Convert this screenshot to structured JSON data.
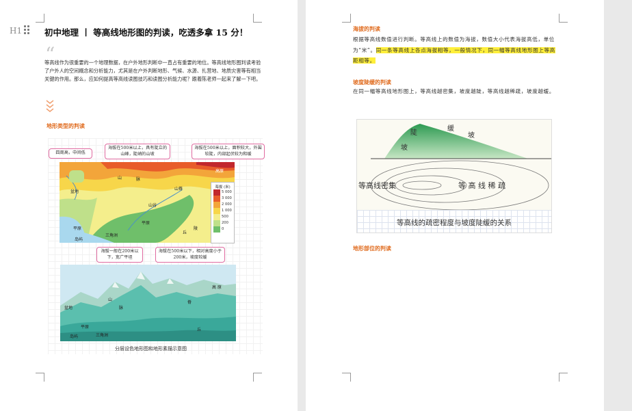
{
  "left_page": {
    "heading_icon": "H1",
    "title": "初中地理 丨 等高线地形图的判读，吃透多拿 15 分！",
    "quote_mark": "“",
    "intro": "等高线作为很重要的一个地理数据，在户外地形判断中一直占有重要的地位。等高线地形图判读考验了户外人的空间概念和分析能力，尤其是在户外判断地形、气候、水源、扎营地、地质灾害等有相当关键的作用。那么，应如何提高等高线读图技巧和读图分析能力呢？跟着陈老师一起来了解一下吧。",
    "section_heading": "地形类型的判读",
    "callouts": {
      "basin": "四周高，中间低",
      "mountain": "海拔在500米以上，具有陡立的山峰，陡峭的山坡",
      "plateau": "海拔在500米以上，面积较大，外围较陡，内部起伏较为和缓",
      "plain": "海拔一般在200米以下，宽广平坦",
      "hills": "海拔在500米以下，相对高度小于200米，坡度较缓"
    },
    "map_labels": {
      "basin": "盆地",
      "mountain": "山",
      "range": "脉",
      "ridge": "山脊",
      "plateau": "高原",
      "valley": "山谷",
      "plain": "平原",
      "plain2": "平原",
      "delta": "三角洲",
      "island": "岛屿",
      "hills": "丘",
      "hills2": "陵"
    },
    "legend": {
      "title": "海拔 (米)",
      "rows": [
        {
          "value": "5 000",
          "color": "#c1272d"
        },
        {
          "value": "3 000",
          "color": "#e85c2a"
        },
        {
          "value": "2 000",
          "color": "#f3a53a"
        },
        {
          "value": "1 000",
          "color": "#f7d64a"
        },
        {
          "value": "500",
          "color": "#f4ee8c"
        },
        {
          "value": "200",
          "color": "#bfe08a"
        },
        {
          "value": "0",
          "color": "#6fbf6a"
        }
      ],
      "sea_color": "#a9d8ee"
    },
    "relief_labels": {
      "mountain": "山",
      "range": "脉",
      "plateau": "高 原",
      "basin": "盆地",
      "plain": "平原",
      "delta": "三角洲",
      "island": "岛屿",
      "hills": "丘",
      "ridge": "脊"
    },
    "caption": "分层设色地形图和地形素描示意图"
  },
  "right_page": {
    "section1_heading": "海拔的判读",
    "section1_text_plain": "根据等高线数值进行判断。等高线上的数值为海拔，数值大小代表海拔高低，单位为“米”。",
    "section1_text_highlight": "同一条等高线上各点海拔相等，一般情况下，同一幅等高线地形图上等高距相等。",
    "section2_heading": "坡度陡缓的判读",
    "section2_text": "在同一幅等高线地形图上，等高线越密集，坡度越陡，等高线越稀疏，坡度越缓。",
    "figure": {
      "steep_label": "陡",
      "steep_label2": "坡",
      "gentle_label": "缓",
      "gentle_label2": "坡",
      "dense_text": "等高线密集",
      "sparse_text": "等 高 线 稀 疏",
      "caption": "等高线的疏密程度与坡度陡缓的关系"
    },
    "section3_heading": "地形部位的判读"
  },
  "colors": {
    "accent_orange": "#e06b1e",
    "highlight": "#ffef3a",
    "callout_border": "#e06aa0"
  }
}
